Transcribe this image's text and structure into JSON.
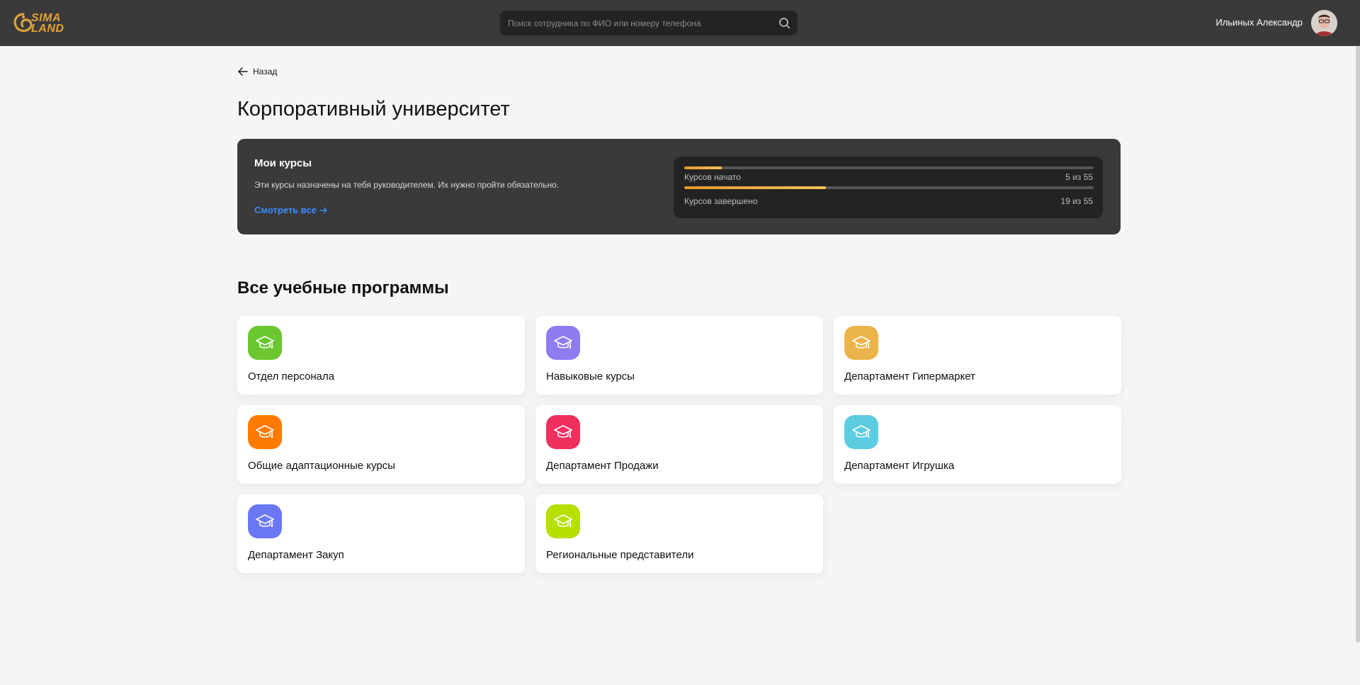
{
  "header": {
    "logo_text_line1": "SIMA",
    "logo_text_line2": "LAND",
    "search_placeholder": "Поиск сотрудника по ФИО или номеру телефона",
    "user_name": "Ильиных Александр"
  },
  "back_label": "Назад",
  "page_title": "Корпоративный университет",
  "my_courses": {
    "title": "Мои курсы",
    "description": "Эти курсы назначены на тебя руководителем. Их нужно пройти обязательно.",
    "link_label": "Смотреть все",
    "started": {
      "label": "Курсов начато",
      "count": "5 из 55",
      "value": 5,
      "total": 55
    },
    "completed": {
      "label": "Курсов завершено",
      "count": "19 из 55",
      "value": 19,
      "total": 55
    }
  },
  "programs_title": "Все учебные программы",
  "programs": [
    {
      "label": "Отдел персонала",
      "color": "#6ac72f"
    },
    {
      "label": "Навыковые курсы",
      "color": "#8c7cf0"
    },
    {
      "label": "Департамент Гипермаркет",
      "color": "#ebb44a"
    },
    {
      "label": "Общие адаптационные курсы",
      "color": "#ff7a00"
    },
    {
      "label": "Департамент Продажи",
      "color": "#ef2f5e"
    },
    {
      "label": "Департамент Игрушка",
      "color": "#5ccde0"
    },
    {
      "label": "Департамент Закуп",
      "color": "#6a78f5"
    },
    {
      "label": "Региональные представители",
      "color": "#b5e000"
    }
  ]
}
